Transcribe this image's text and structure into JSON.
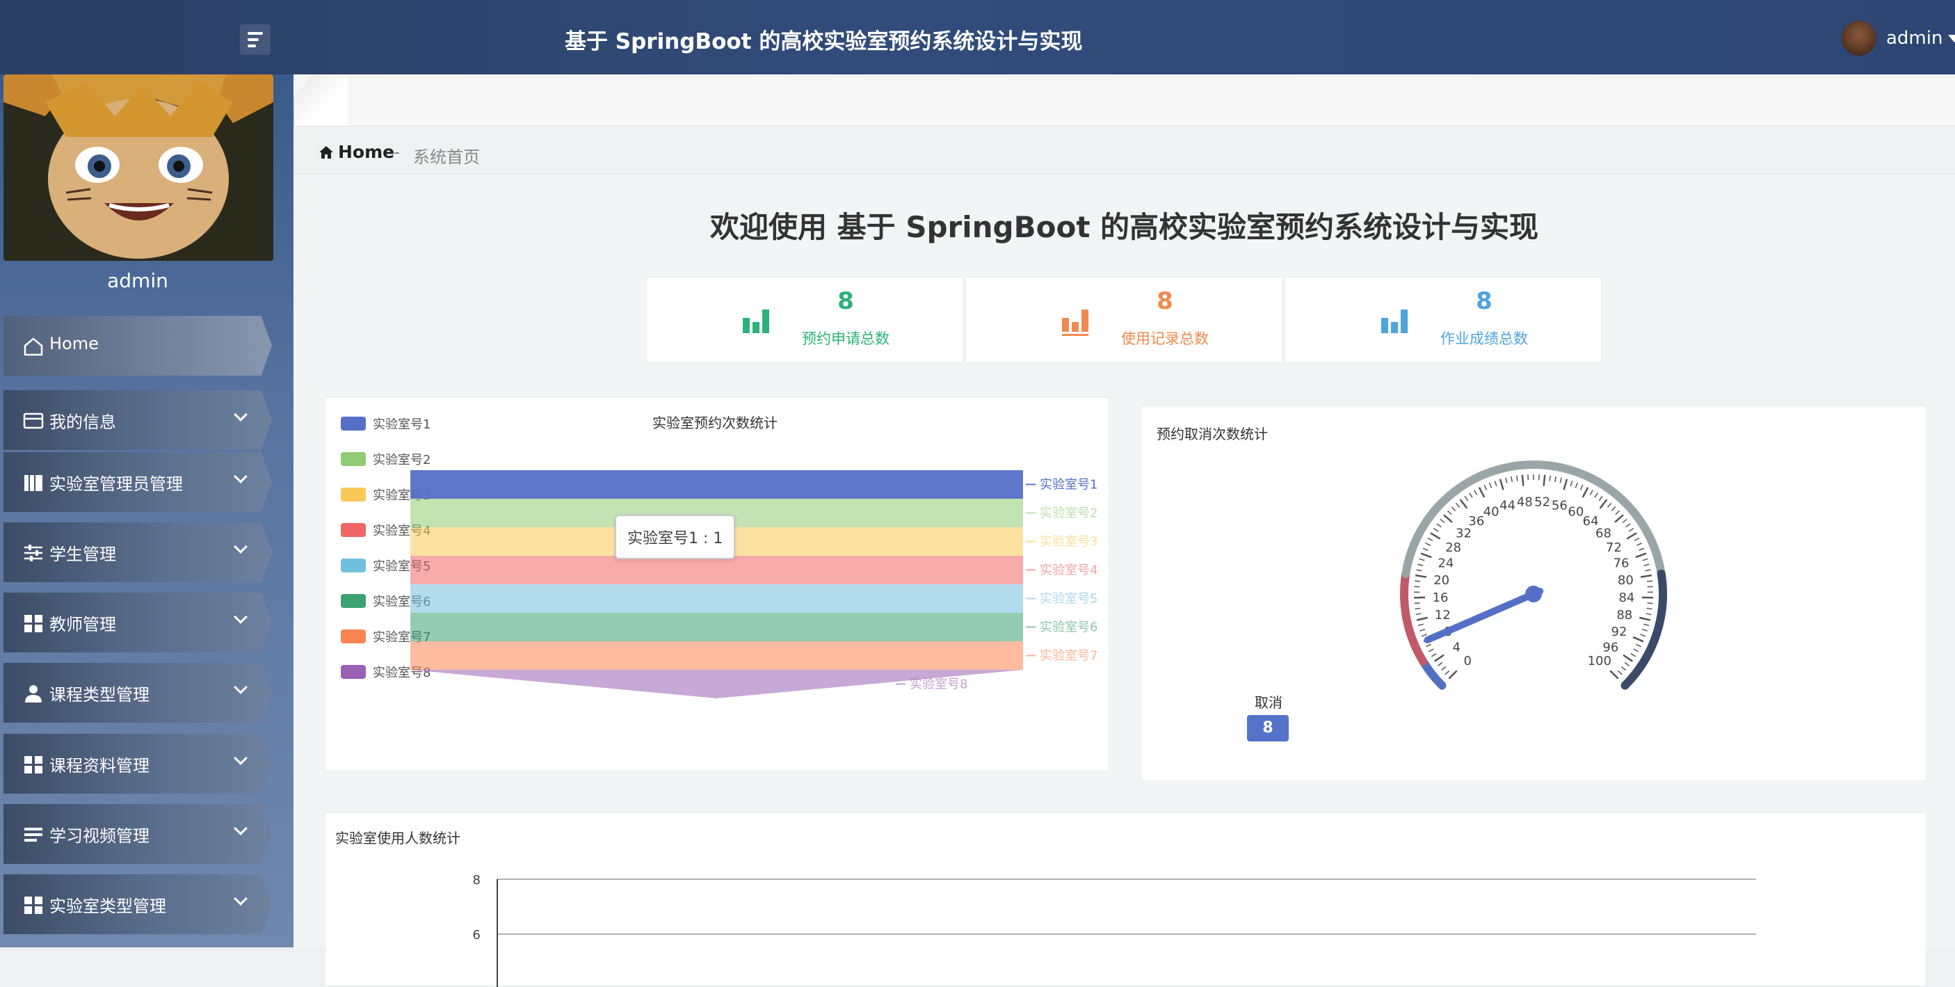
{
  "header": {
    "title": "基于 SpringBoot 的高校实验室预约系统设计与实现",
    "user_name": "admin"
  },
  "sidebar": {
    "user_name": "admin",
    "items": [
      {
        "label": "Home",
        "icon": "home-icon"
      },
      {
        "label": "我的信息",
        "icon": "wallet-icon"
      },
      {
        "label": "实验室管理员管理",
        "icon": "books-icon"
      },
      {
        "label": "学生管理",
        "icon": "sliders-icon"
      },
      {
        "label": "教师管理",
        "icon": "grid-icon"
      },
      {
        "label": "课程类型管理",
        "icon": "user-icon"
      },
      {
        "label": "课程资料管理",
        "icon": "grid-icon"
      },
      {
        "label": "学习视频管理",
        "icon": "list-icon"
      },
      {
        "label": "实验室类型管理",
        "icon": "grid-icon"
      }
    ]
  },
  "breadcrumb": {
    "home": "Home",
    "separator": "-",
    "current": "系统首页"
  },
  "welcome": "欢迎使用 基于 SpringBoot 的高校实验室预约系统设计与实现",
  "stats": [
    {
      "value": "8",
      "label": "预约申请总数",
      "color": "#2bb27b"
    },
    {
      "value": "8",
      "label": "使用记录总数",
      "color": "#ef8a4e"
    },
    {
      "value": "8",
      "label": "作业成绩总数",
      "color": "#4ea4dc"
    }
  ],
  "chart_data": [
    {
      "type": "funnel",
      "title": "实验室预约次数统计",
      "categories": [
        "实验室号1",
        "实验室号2",
        "实验室号3",
        "实验室号4",
        "实验室号5",
        "实验室号6",
        "实验室号7",
        "实验室号8"
      ],
      "values": [
        1,
        1,
        1,
        1,
        1,
        1,
        1,
        1
      ],
      "colors": [
        "#5470c6",
        "#91cc75",
        "#fac858",
        "#ee6666",
        "#73c0de",
        "#3ba272",
        "#fc8452",
        "#9a60b4"
      ],
      "legend_position": "left",
      "tooltip": "实验室号1 : 1"
    },
    {
      "type": "gauge",
      "title": "预约取消次数统计",
      "min": 0,
      "max": 100,
      "ticks": [
        "0",
        "4",
        "8",
        "12",
        "16",
        "20",
        "24",
        "28",
        "32",
        "36",
        "40",
        "44",
        "48",
        "52",
        "56",
        "60",
        "64",
        "68",
        "72",
        "76",
        "80",
        "84",
        "88",
        "92",
        "96",
        "100"
      ],
      "series_name": "取消",
      "value": 8,
      "value_label": "8"
    },
    {
      "type": "line",
      "title": "实验室使用人数统计",
      "y_ticks": [
        "8",
        "6"
      ]
    }
  ]
}
